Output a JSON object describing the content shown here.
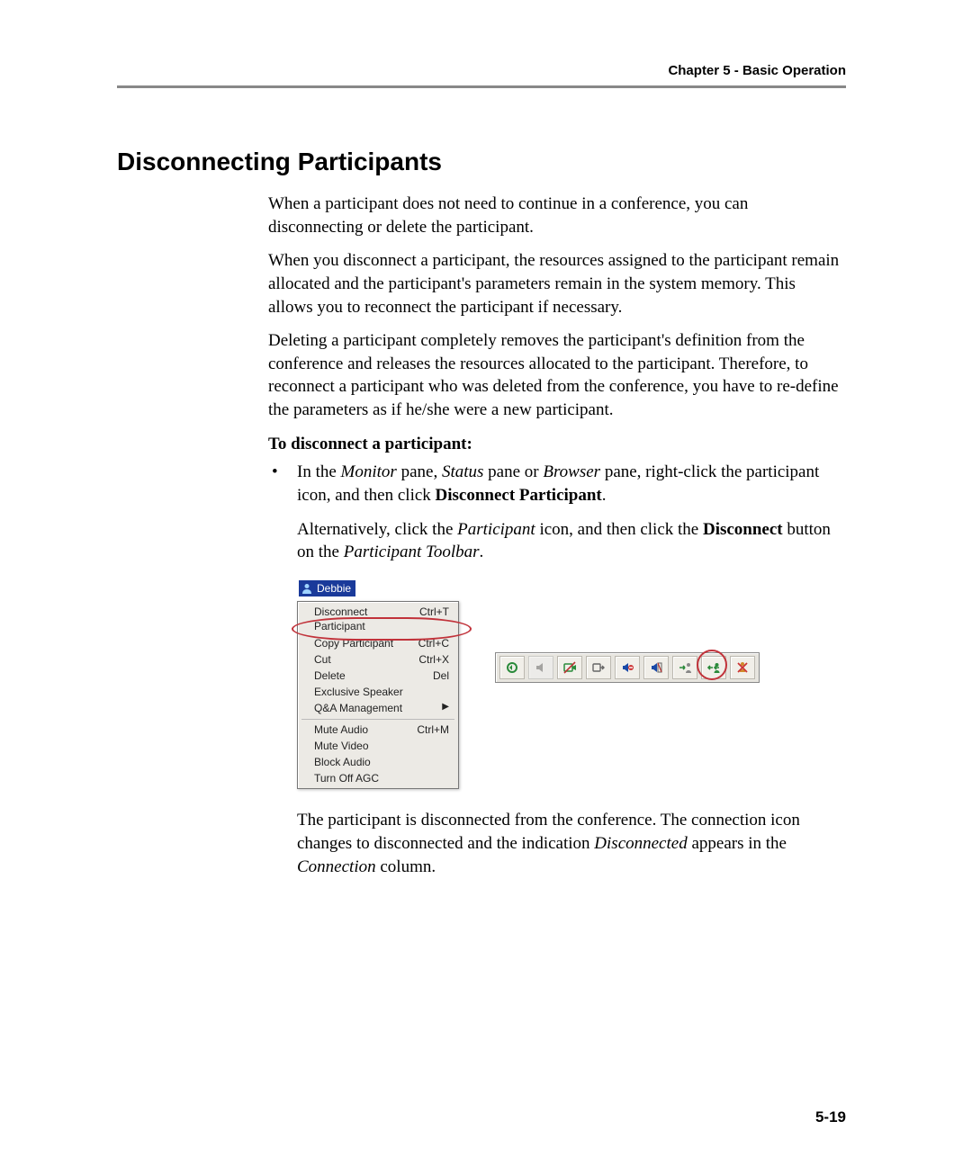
{
  "header": {
    "chapter": "Chapter 5 - Basic Operation"
  },
  "title": "Disconnecting Participants",
  "paragraphs": {
    "p1": "When a participant does not need to continue in a conference, you can disconnecting or delete the participant.",
    "p2": "When you disconnect a participant, the resources assigned to the participant remain allocated and the participant's parameters remain in the system memory. This allows you to reconnect the participant if necessary.",
    "p3": "Deleting a participant completely removes the participant's definition from the conference and releases the resources allocated to the participant. Therefore, to reconnect a participant who was deleted from the conference, you have to re-define the parameters as if he/she were a new participant."
  },
  "subhead": "To disconnect a participant:",
  "bullet": {
    "l1a": "In the ",
    "l1b": "Monitor",
    "l1c": " pane, ",
    "l1d": "Status",
    "l1e": " pane or ",
    "l1f": "Browser",
    "l1g": " pane, right-click the participant icon, and then click ",
    "l1h": "Disconnect Participant",
    "l1i": ".",
    "l2a": "Alternatively, click the ",
    "l2b": "Participant",
    "l2c": " icon, and then click the ",
    "l2d": "Disconnect",
    "l2e": " button on the ",
    "l2f": "Participant Toolbar",
    "l2g": "."
  },
  "context_menu": {
    "participant_name": "Debbie",
    "items": [
      {
        "label": "Disconnect Participant",
        "shortcut": "Ctrl+T"
      },
      {
        "label": "Copy Participant",
        "shortcut": "Ctrl+C"
      },
      {
        "label": "Cut",
        "shortcut": "Ctrl+X"
      },
      {
        "label": "Delete",
        "shortcut": "Del"
      },
      {
        "label": "Exclusive Speaker",
        "shortcut": ""
      },
      {
        "label": "Q&A Management",
        "shortcut": "",
        "submenu": true
      }
    ],
    "items2": [
      {
        "label": "Mute Audio",
        "shortcut": "Ctrl+M"
      },
      {
        "label": "Mute Video",
        "shortcut": ""
      },
      {
        "label": "Block Audio",
        "shortcut": ""
      },
      {
        "label": "Turn Off AGC",
        "shortcut": ""
      }
    ]
  },
  "toolbar": {
    "icons": [
      "connect-icon",
      "speaker-left-icon",
      "mute-video-icon",
      "video-output-icon",
      "mute-audio-icon",
      "block-audio-icon",
      "add-participant-icon",
      "disconnect-icon",
      "delete-participant-icon"
    ]
  },
  "after": {
    "a1": "The participant is disconnected from the conference. The connection icon changes to disconnected and the indication ",
    "a2": "Disconnected",
    "a3": " appears in the ",
    "a4": "Connection",
    "a5": " column."
  },
  "footer": {
    "page": "5-19"
  }
}
